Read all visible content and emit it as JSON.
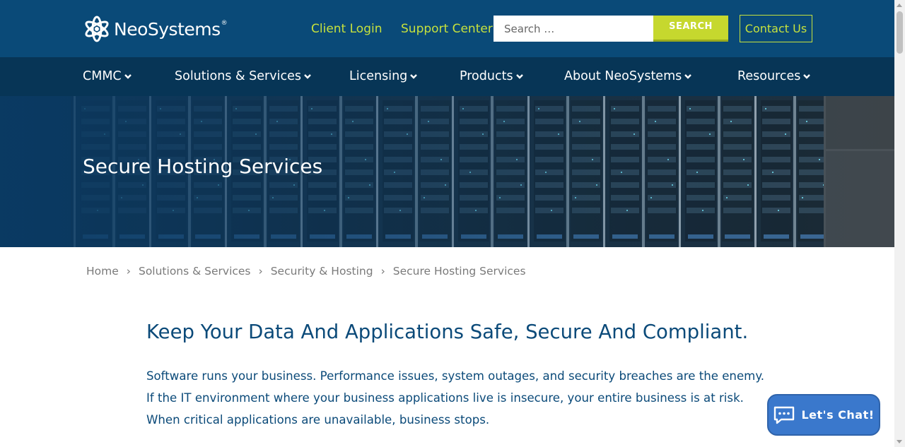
{
  "header": {
    "logo_text": "NeoSystems",
    "logo_mark": "®",
    "client_login": "Client Login",
    "support_center": "Support Center",
    "search_placeholder": "Search …",
    "search_button": "SEARCH",
    "contact_us": "Contact Us"
  },
  "nav": {
    "items": [
      {
        "label": "CMMC"
      },
      {
        "label": "Solutions & Services"
      },
      {
        "label": "Licensing"
      },
      {
        "label": "Products"
      },
      {
        "label": "About NeoSystems"
      },
      {
        "label": "Resources"
      }
    ]
  },
  "hero": {
    "title": "Secure Hosting Services"
  },
  "breadcrumb": {
    "items": [
      "Home",
      "Solutions & Services",
      "Security & Hosting",
      "Secure Hosting Services"
    ],
    "separator": "›"
  },
  "content": {
    "heading": "Keep Your Data And Applications Safe, Secure And Compliant.",
    "paragraph": "Software runs your business. Performance issues, system outages, and security breaches are the enemy. If the IT environment where your business applications live is insecure, your entire business is at risk. When critical applications are unavailable, business stops."
  },
  "chat": {
    "label": "Let's Chat!",
    "icon": "chat-bubble-icon"
  },
  "colors": {
    "header_bg": "#0a4a78",
    "nav_bg": "#073556",
    "accent_green": "#c6e13d",
    "search_button_bg": "#c6d82e",
    "heading_blue": "#0b4a79",
    "chat_blue": "#3a78cc"
  }
}
